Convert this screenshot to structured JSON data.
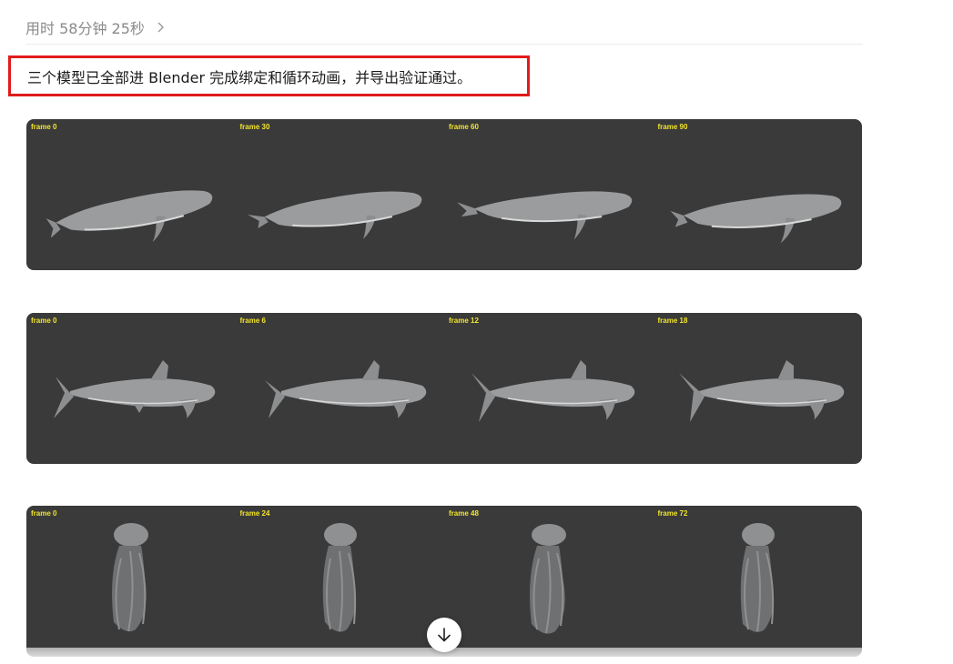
{
  "header": {
    "elapsed_label": "用时 58分钟 25秒"
  },
  "summary": {
    "text": "三个模型已全部进 Blender 完成绑定和循环动画，并导出验证通过。"
  },
  "strips": [
    {
      "model": "whale",
      "frames": [
        "frame 0",
        "frame 30",
        "frame 60",
        "frame 90"
      ]
    },
    {
      "model": "shark",
      "frames": [
        "frame 0",
        "frame 6",
        "frame 12",
        "frame 18"
      ]
    },
    {
      "model": "jellyfish",
      "frames": [
        "frame 0",
        "frame 24",
        "frame 48",
        "frame 72"
      ]
    }
  ],
  "colors": {
    "strip_bg": "#3a3a3a",
    "frame_label": "#f2e52c",
    "highlight_border": "#e01b1b",
    "model_fill": "#9a9c9e"
  },
  "icons": {
    "chevron": "chevron-right-icon",
    "scroll": "arrow-down-icon"
  }
}
